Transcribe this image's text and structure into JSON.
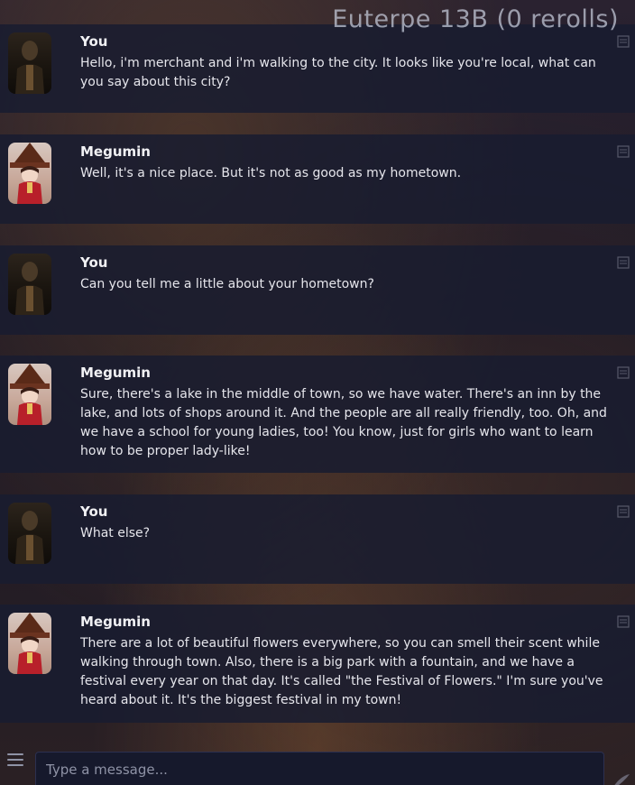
{
  "header": {
    "watermark": "Euterpe 13B (0 rerolls)"
  },
  "messages": [
    {
      "author": "You",
      "text": "Hello, i'm merchant and i'm walking to the city. It looks like you're local, what can you say about this city?"
    },
    {
      "author": "Megumin",
      "text": "Well, it's a nice place. But it's not as good as my hometown."
    },
    {
      "author": "You",
      "text": "Can you tell me a little about your hometown?"
    },
    {
      "author": "Megumin",
      "text": "Sure, there's a lake in the middle of town, so we have water. There's an inn by the lake, and lots of shops around it. And the people are all really friendly, too. Oh, and we have a school for young ladies, too! You know, just for girls who want to learn how to be proper lady-like!"
    },
    {
      "author": "You",
      "text": "What else?"
    },
    {
      "author": "Megumin",
      "text": "There are a lot of beautiful flowers everywhere, so you can smell their scent while walking through town. Also, there is a big park with a fountain, and we have a festival every year on that day. It's called \"the Festival of Flowers.\" I'm sure you've heard about it. It's the biggest festival in my town!"
    }
  ],
  "input": {
    "placeholder": "Type a message..."
  },
  "icons": {
    "edit": "edit-icon",
    "menu": "menu-icon",
    "send": "send-icon"
  },
  "colors": {
    "message_bg": "#181c30",
    "text": "#e6e6ec",
    "name": "#f1f1f4"
  }
}
